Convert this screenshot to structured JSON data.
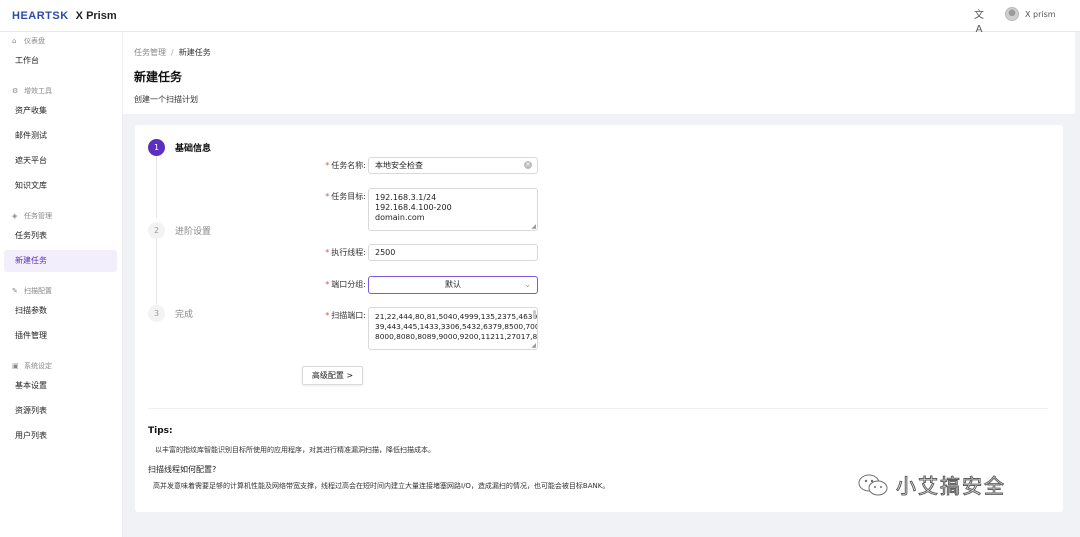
{
  "header": {
    "logo_mark": "HEARTSK",
    "app_name": "X Prism",
    "lang_icon": "translate-icon",
    "username": "X prism"
  },
  "sidebar": {
    "groups": [
      {
        "icon": "home-icon",
        "label": "仪表盘",
        "items": [
          "工作台"
        ]
      },
      {
        "icon": "gear-icon",
        "label": "增效工具",
        "items": [
          "资产收集",
          "邮件测试",
          "遮天平台",
          "知识文库"
        ]
      },
      {
        "icon": "task-icon",
        "label": "任务管理",
        "items": [
          "任务列表",
          "新建任务"
        ]
      },
      {
        "icon": "edit-icon",
        "label": "扫描配置",
        "items": [
          "扫描参数",
          "插件管理"
        ]
      },
      {
        "icon": "settings-icon",
        "label": "系统设定",
        "items": [
          "基本设置",
          "资源列表",
          "用户列表"
        ]
      }
    ],
    "active_item": "新建任务"
  },
  "page": {
    "breadcrumb": [
      "任务管理",
      "新建任务"
    ],
    "breadcrumb_sep": "/",
    "title": "新建任务",
    "description": "创建一个扫描计划"
  },
  "steps": [
    {
      "num": "1",
      "label": "基础信息",
      "active": true
    },
    {
      "num": "2",
      "label": "进阶设置",
      "active": false
    },
    {
      "num": "3",
      "label": "完成",
      "active": false
    }
  ],
  "form": {
    "task_name": {
      "label": "任务名称:",
      "value": "本地安全检查"
    },
    "task_target": {
      "label": "任务目标:",
      "lines": [
        "192.168.3.1/24",
        "192.168.4.100-200",
        "domain.com"
      ]
    },
    "threads": {
      "label": "执行线程:",
      "value": "2500"
    },
    "port_group": {
      "label": "端口分组:",
      "value": "默认"
    },
    "scan_ports": {
      "label": "扫描端口:",
      "lines": [
        "21,22,444,80,81,5040,4999,135,2375,4630,1",
        "39,443,445,1433,3306,5432,6379,8500,7001,",
        "8000,8080,8089,9000,9200,11211,27017,82,"
      ]
    },
    "advanced_button": "高级配置 >"
  },
  "tips": {
    "title": "Tips:",
    "line1": "以丰富的指纹库智能识别目标所使用的应用程序，对其进行精准漏洞扫描，降低扫描成本。",
    "question": "扫描线程如何配置?",
    "line2": "高并发意味着需要足够的计算机性能及网络带宽支撑，线程过高会在短时间内建立大量连接堵塞网路I/O，造成漏扫的情况，也可能会被目标BANK。"
  },
  "watermark": {
    "text": "小艾搞安全",
    "icon": "wechat-icon"
  },
  "colors": {
    "accent": "#5a2fc2",
    "active_bg": "#f3eefc",
    "required": "#e05050"
  }
}
